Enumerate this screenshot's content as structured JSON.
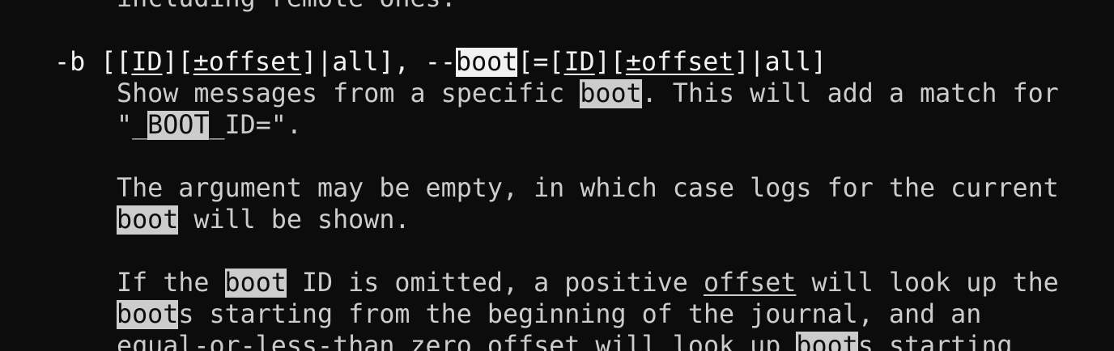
{
  "colors": {
    "background": "#0c0c0c",
    "text": "#cccccc",
    "bright_text": "#f2f2f2",
    "search_highlight": "#cccccc",
    "current_match_highlight": "#f2f2f2"
  },
  "man_page": {
    "search_term": "boot",
    "lines": [
      {
        "segments": [
          "including remote ones."
        ]
      },
      {
        "segments": [
          "-b [[",
          "ID",
          "][",
          "±offset",
          "]|all], --",
          "boot",
          "[=[",
          "ID",
          "][",
          "±offset",
          "]|all]"
        ]
      },
      {
        "segments": [
          "Show messages from a specific ",
          "boot",
          ". This will add a match for"
        ]
      },
      {
        "segments": [
          "\"_",
          "BOOT",
          "_ID=\"."
        ]
      },
      {
        "segments": [
          "The argument may be empty, in which case logs for the current"
        ]
      },
      {
        "segments": [
          "boot",
          " will be shown."
        ]
      },
      {
        "segments": [
          "If the ",
          "boot",
          " ID is omitted, a positive ",
          "offset",
          " will look up the"
        ]
      },
      {
        "segments": [
          "boot",
          "s starting from the beginning of the journal, and an"
        ]
      },
      {
        "segments": [
          "equal-or-less-than zero offset will look up ",
          "boot",
          "s starting"
        ]
      }
    ]
  }
}
